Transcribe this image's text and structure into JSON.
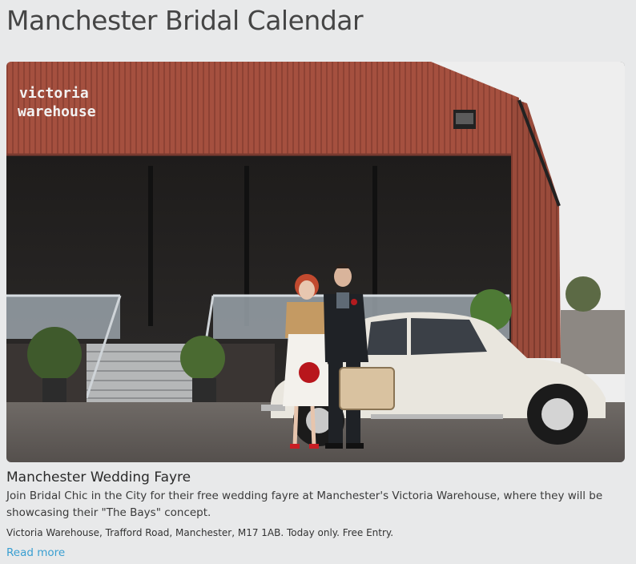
{
  "page": {
    "title": "Manchester Bridal Calendar"
  },
  "event": {
    "image": {
      "alt": "",
      "sign_line1": "victoria",
      "sign_line2": "warehouse"
    },
    "title": "Manchester Wedding Fayre",
    "description": "Join Bridal Chic in the City for their free wedding fayre at Manchester's Victoria Warehouse, where they will be showcasing their \"The Bays\" concept.",
    "meta": "Victoria Warehouse, Trafford Road, Manchester, M17 1AB. Today only. Free Entry.",
    "read_more": "Read more"
  },
  "colors": {
    "background": "#e8e9ea",
    "link": "#3a9fd1",
    "warehouse_red": "#a5503f"
  }
}
